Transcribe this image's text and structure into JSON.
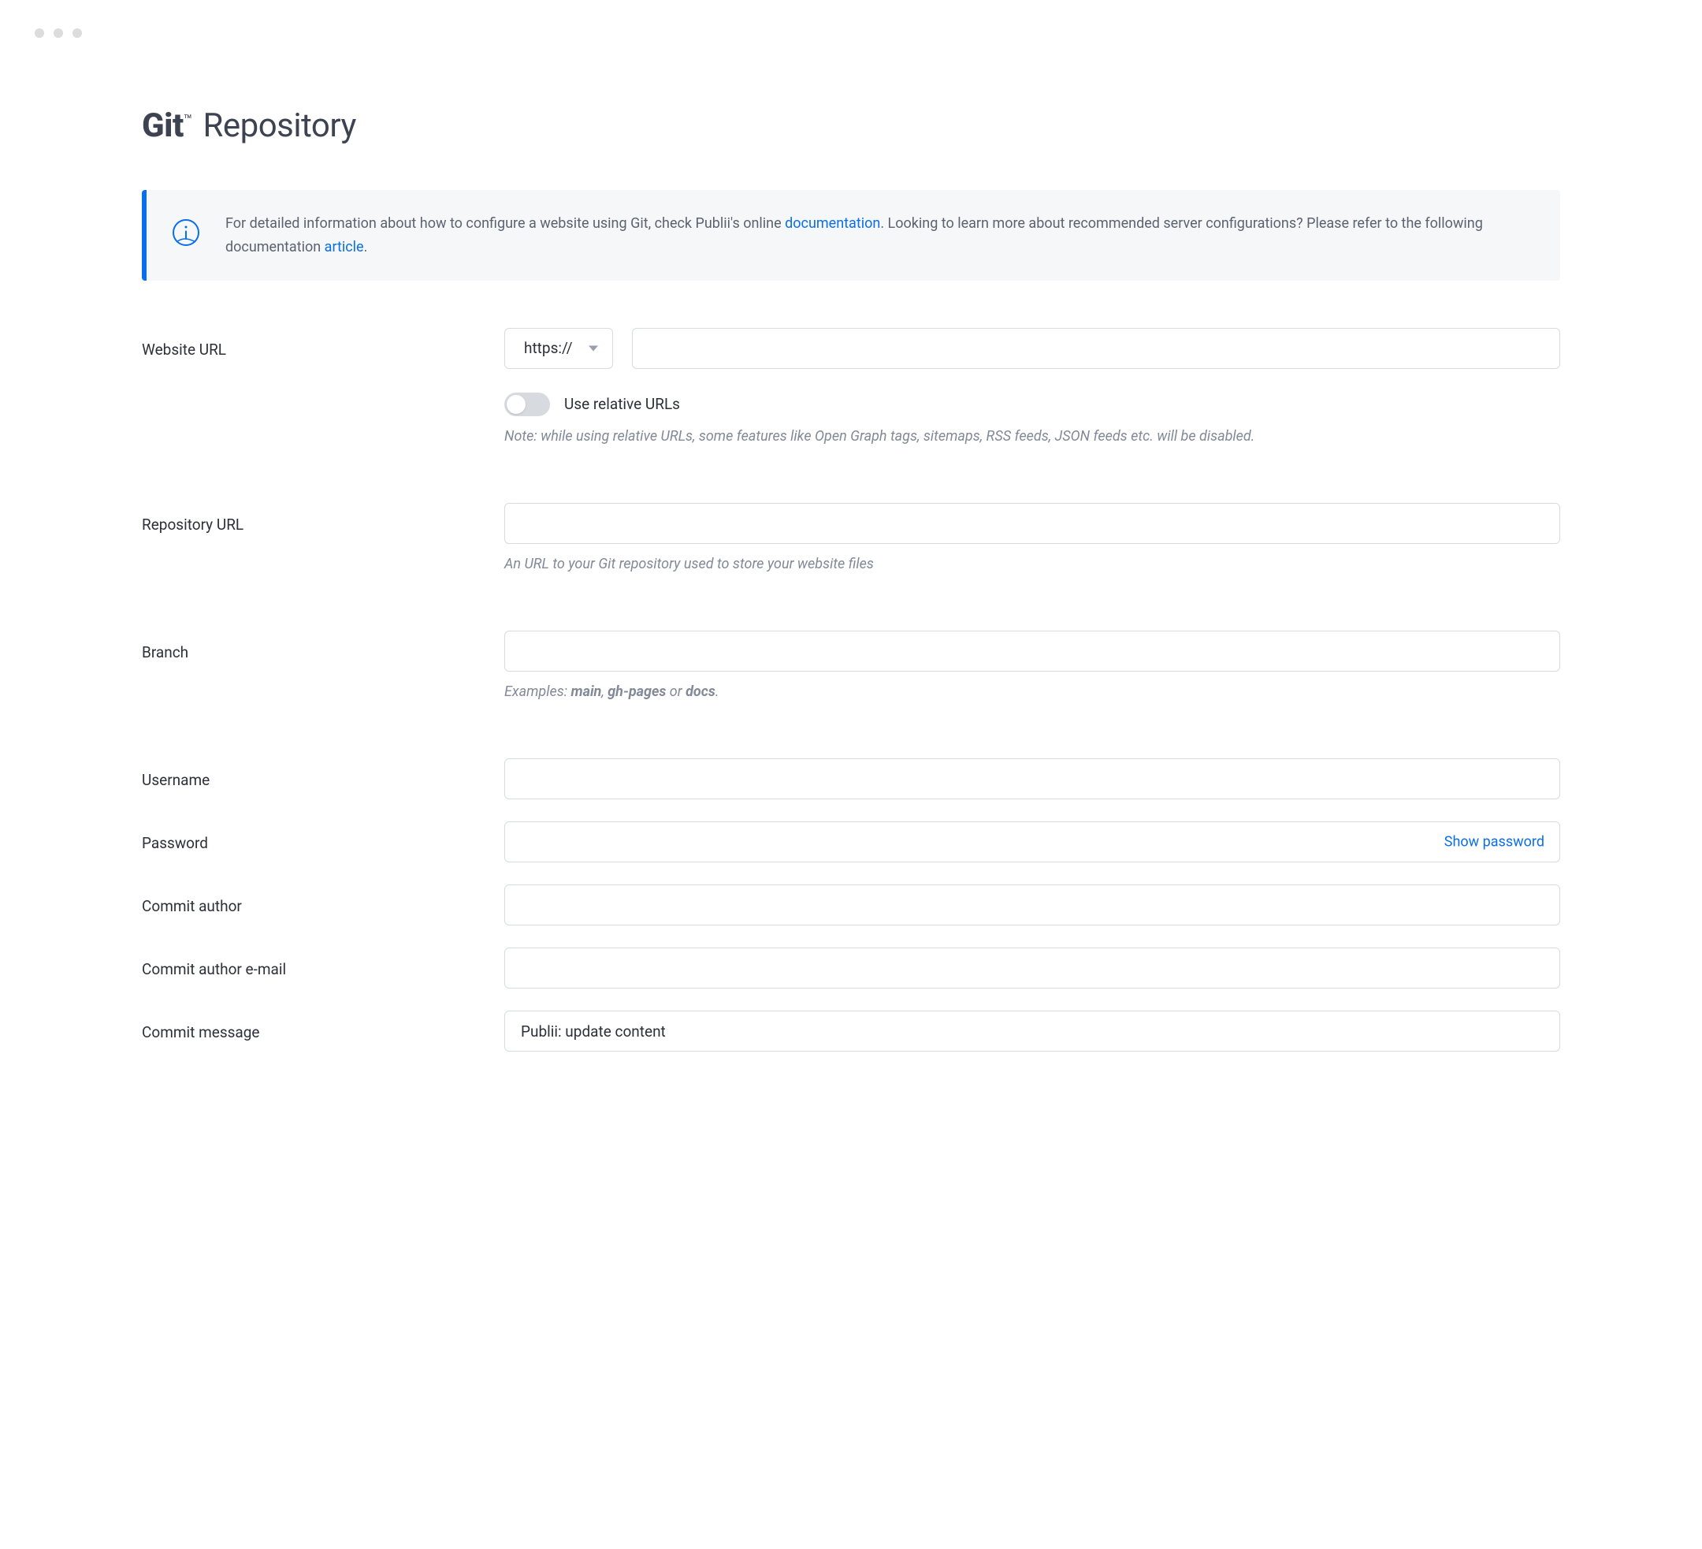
{
  "header": {
    "title_bold": "Git",
    "title_tm": "™",
    "title_rest": " Repository"
  },
  "banner": {
    "text_before": "For detailed information about how to configure a website using Git, check Publii's online ",
    "link1": "documentation",
    "text_middle": ". Looking to learn more about recommended server configurations? Please refer to the following documentation ",
    "link2": "article",
    "text_end": "."
  },
  "form": {
    "website_url": {
      "label": "Website URL",
      "protocol": "https://",
      "value": "",
      "relative_toggle_label": "Use relative URLs",
      "relative_note": "Note: while using relative URLs, some features like Open Graph tags, sitemaps, RSS feeds, JSON feeds etc. will be disabled."
    },
    "repo_url": {
      "label": "Repository URL",
      "value": "",
      "help": "An URL to your Git repository used to store your website files"
    },
    "branch": {
      "label": "Branch",
      "value": "",
      "help_prefix": "Examples: ",
      "help_ex1": "main",
      "help_comma": ", ",
      "help_ex2": "gh-pages",
      "help_or": " or ",
      "help_ex3": "docs",
      "help_period": "."
    },
    "username": {
      "label": "Username",
      "value": ""
    },
    "password": {
      "label": "Password",
      "value": "",
      "show_label": "Show password"
    },
    "commit_author": {
      "label": "Commit author",
      "value": ""
    },
    "commit_email": {
      "label": "Commit author e-mail",
      "value": ""
    },
    "commit_message": {
      "label": "Commit message",
      "value": "Publii: update content"
    }
  }
}
